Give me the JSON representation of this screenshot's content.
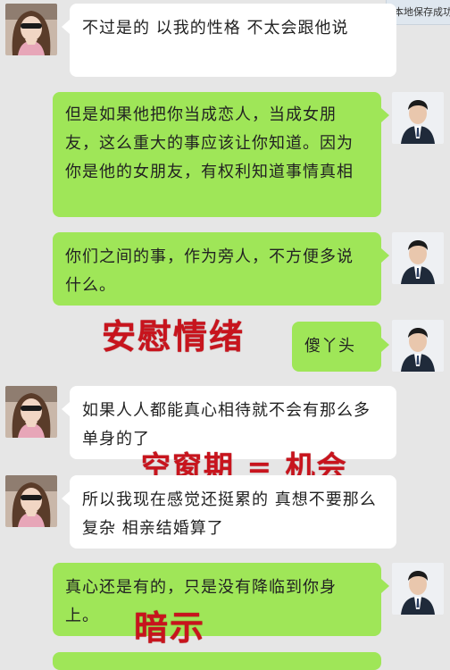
{
  "save_button": {
    "label": "本地保存成功"
  },
  "messages": [
    {
      "side": "left",
      "text": "不过是的 以我的性格 不太会跟他说"
    },
    {
      "side": "right",
      "text": "但是如果他把你当成恋人，当成女朋友，这么重大的事应该让你知道。因为你是他的女朋友，有权利知道事情真相"
    },
    {
      "side": "right",
      "text": "你们之间的事，作为旁人，不方便多说什么。"
    },
    {
      "side": "right",
      "text": "傻丫头"
    },
    {
      "side": "left",
      "text": "如果人人都能真心相待就不会有那么多单身的了"
    },
    {
      "side": "left",
      "text": "所以我现在感觉还挺累的 真想不要那么复杂 相亲结婚算了"
    },
    {
      "side": "right",
      "text": "真心还是有的，只是没有降临到你身上。"
    }
  ],
  "annotations": {
    "comfort": "安慰情绪",
    "vacancy": "空窗期 = 机会",
    "hint": "暗示"
  },
  "colors": {
    "background": "#e6e6e6",
    "bubble_self": "#9fe658",
    "bubble_other": "#ffffff",
    "annotation": "#c8141d"
  },
  "icons": {
    "her_avatar": "woman-avatar-icon",
    "his_avatar": "man-avatar-icon"
  }
}
